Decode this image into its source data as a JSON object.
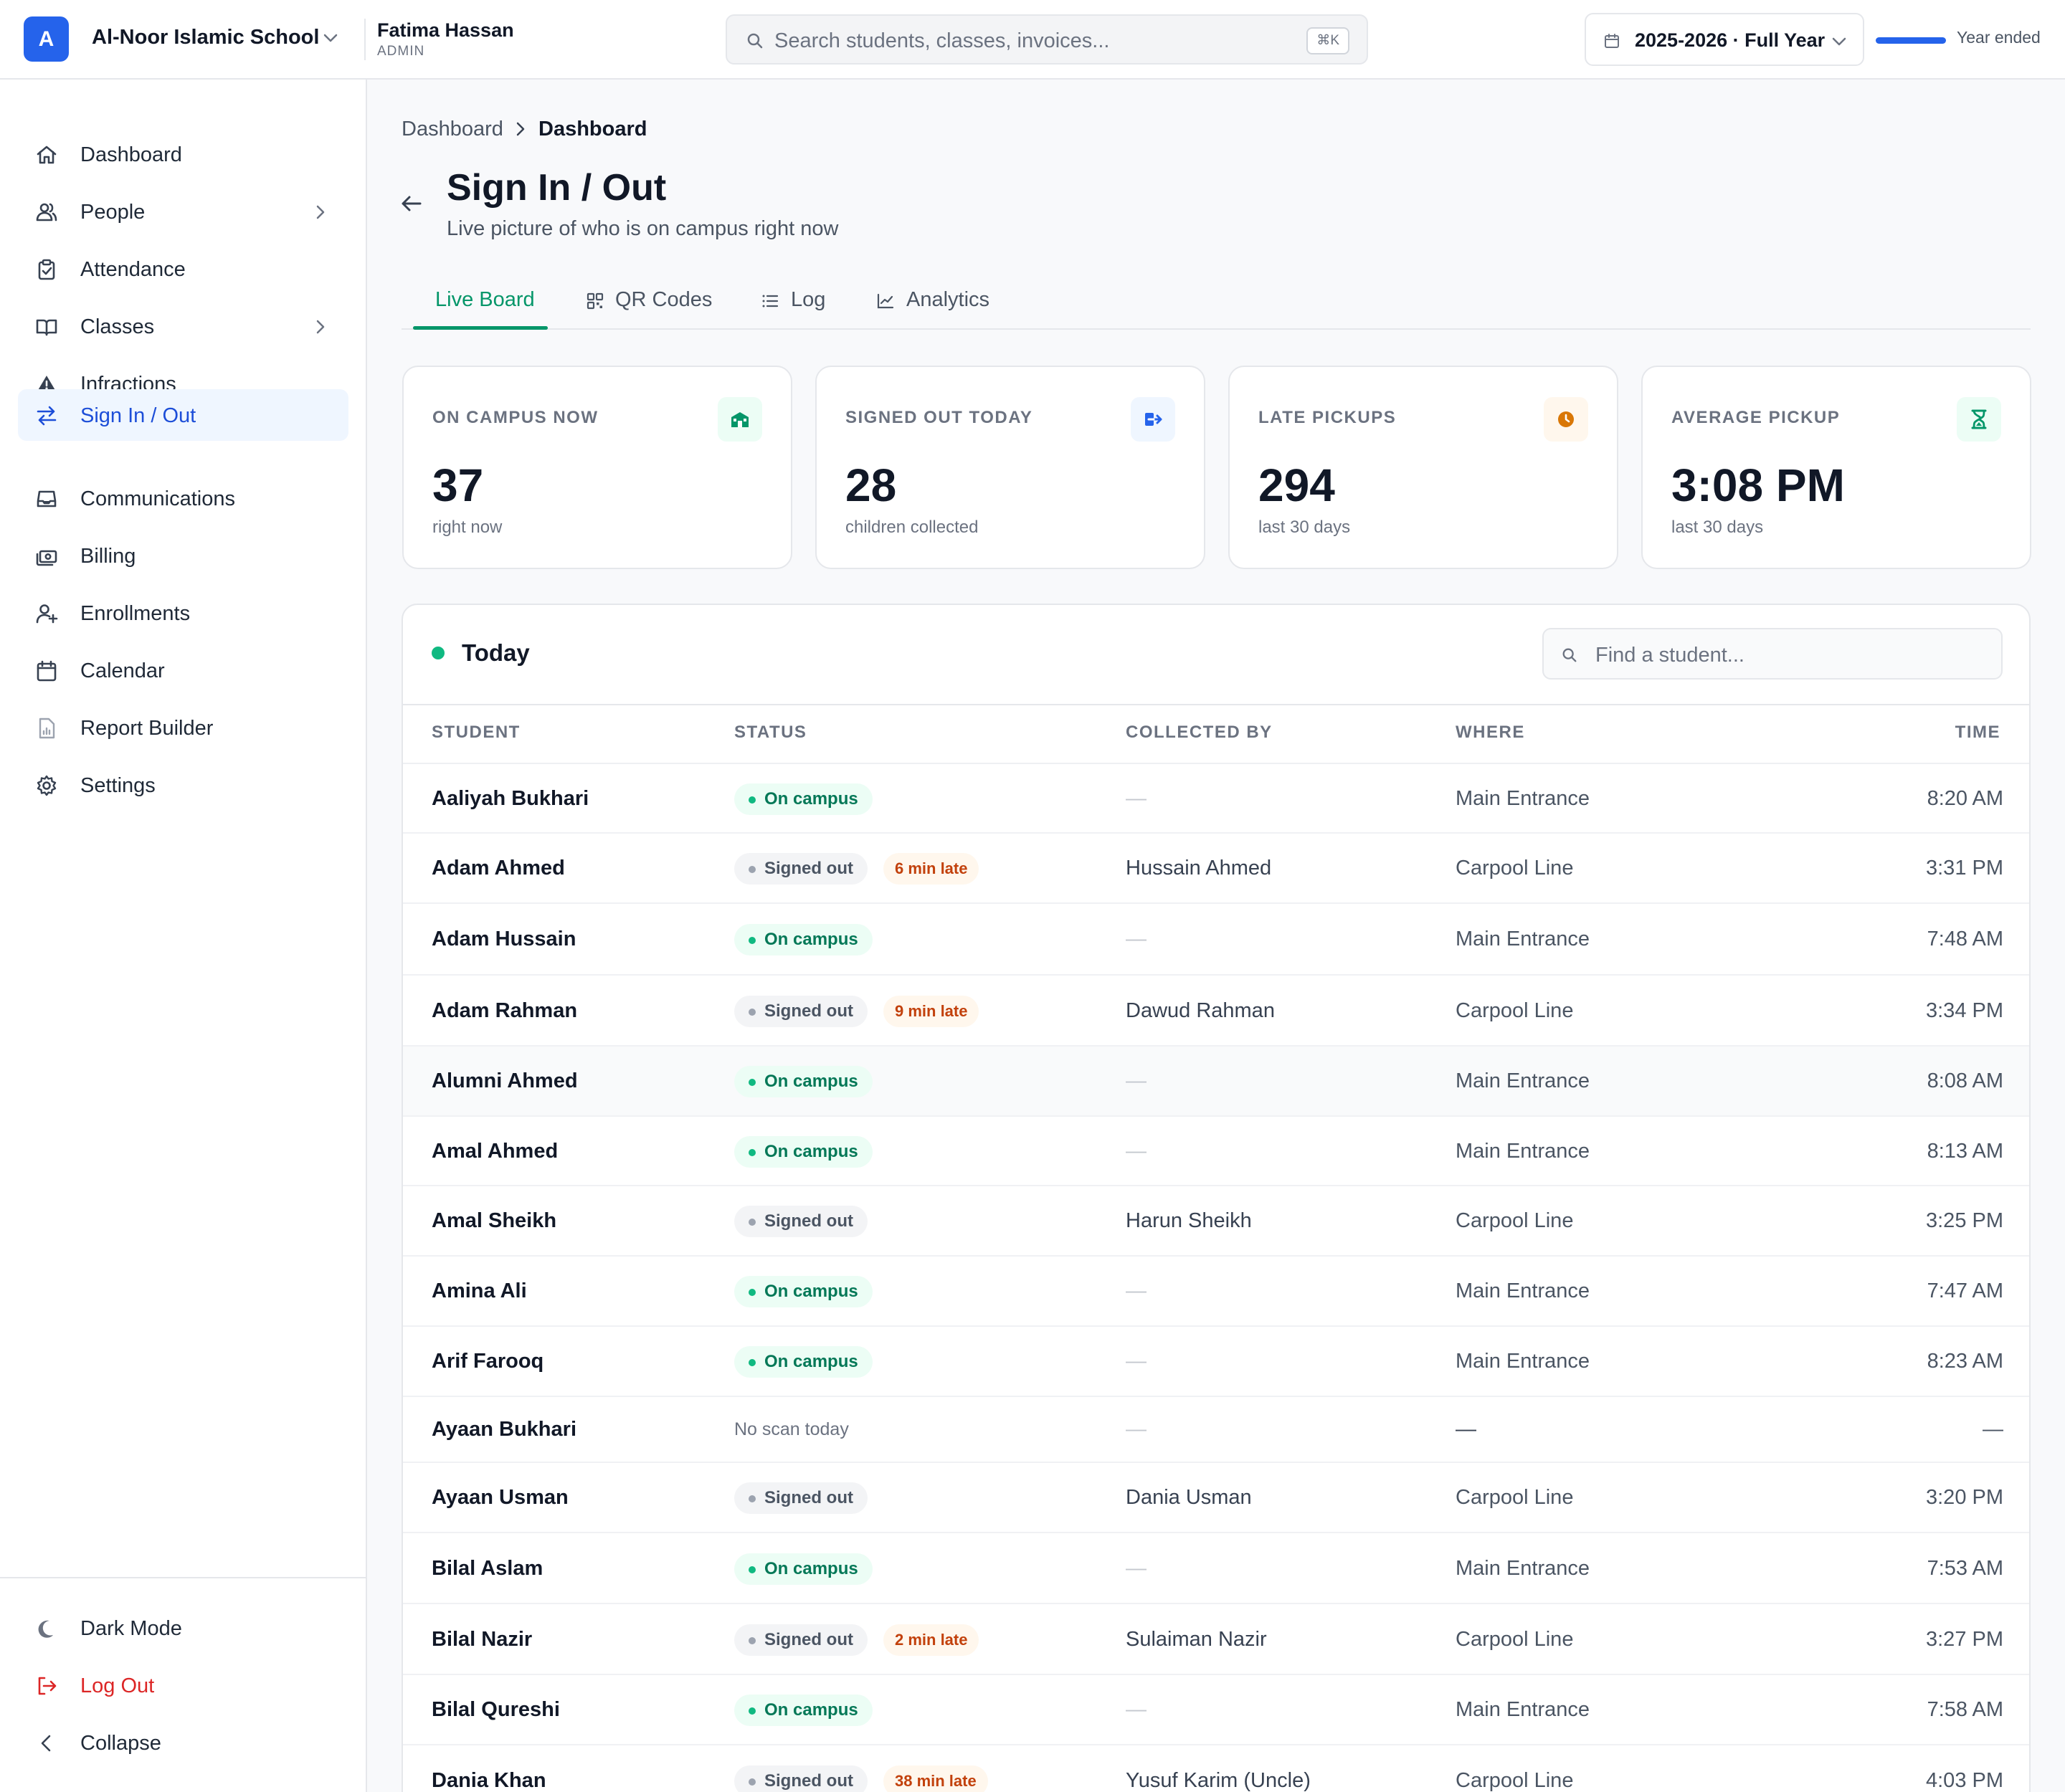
{
  "header": {
    "logo_letter": "A",
    "school": "Al-Noor Islamic School",
    "user_name": "Fatima Hassan",
    "user_role": "ADMIN",
    "search_placeholder": "Search students, classes, invoices...",
    "search_shortcut": "⌘K",
    "year": "2025-2026 · Full Year",
    "year_progress": 1.0,
    "year_status": "Year ended"
  },
  "sidebar": {
    "items": [
      {
        "label": "Dashboard",
        "icon": "home-icon"
      },
      {
        "label": "People",
        "icon": "users-icon",
        "has_children": true
      },
      {
        "label": "Attendance",
        "icon": "clipboard-check-icon"
      },
      {
        "label": "Classes",
        "icon": "book-open-icon",
        "has_children": true
      },
      {
        "label": "Infractions",
        "icon": "warning-icon"
      },
      {
        "label": "Sign In / Out",
        "icon": "arrows-swap-icon",
        "active": true
      },
      {
        "label": "Communications",
        "icon": "inbox-icon"
      },
      {
        "label": "Billing",
        "icon": "banknote-icon"
      },
      {
        "label": "Enrollments",
        "icon": "user-plus-icon"
      },
      {
        "label": "Calendar",
        "icon": "calendar-icon"
      },
      {
        "label": "Report Builder",
        "icon": "report-icon"
      },
      {
        "label": "Settings",
        "icon": "gear-icon"
      }
    ],
    "bottom": {
      "dark_mode": "Dark Mode",
      "log_out": "Log Out",
      "collapse": "Collapse"
    }
  },
  "breadcrumb": {
    "first": "Dashboard",
    "current": "Dashboard"
  },
  "page": {
    "title": "Sign In / Out",
    "subtitle": "Live picture of who is on campus right now"
  },
  "tabs": [
    {
      "label": "Live Board",
      "active": true
    },
    {
      "label": "QR Codes",
      "icon": "qr-icon"
    },
    {
      "label": "Log",
      "icon": "list-icon"
    },
    {
      "label": "Analytics",
      "icon": "chart-icon"
    }
  ],
  "stats": [
    {
      "label": "ON CAMPUS NOW",
      "value": "37",
      "sub": "right now",
      "icon": "school-icon",
      "color": "#059669",
      "bg": "#ecfdf5"
    },
    {
      "label": "SIGNED OUT TODAY",
      "value": "28",
      "sub": "children collected",
      "icon": "sign-out-icon",
      "color": "#2563eb",
      "bg": "#eff6ff"
    },
    {
      "label": "LATE PICKUPS",
      "value": "294",
      "sub": "last 30 days",
      "icon": "clock-icon",
      "color": "#d97706",
      "bg": "#fff7ed"
    },
    {
      "label": "AVERAGE PICKUP",
      "value": "3:08 PM",
      "sub": "last 30 days",
      "icon": "hourglass-icon",
      "color": "#059669",
      "bg": "#ecfdf5"
    }
  ],
  "today": {
    "title": "Today",
    "find_placeholder": "Find a student...",
    "columns": [
      "STUDENT",
      "STATUS",
      "COLLECTED BY",
      "WHERE",
      "TIME"
    ],
    "rows": [
      {
        "name": "Aaliyah Bukhari",
        "status": "On campus",
        "late": "",
        "by": "—",
        "where": "Main Entrance",
        "time": "8:20 AM"
      },
      {
        "name": "Adam Ahmed",
        "status": "Signed out",
        "late": "6 min late",
        "by": "Hussain Ahmed",
        "where": "Carpool Line",
        "time": "3:31 PM"
      },
      {
        "name": "Adam Hussain",
        "status": "On campus",
        "late": "",
        "by": "—",
        "where": "Main Entrance",
        "time": "7:48 AM"
      },
      {
        "name": "Adam Rahman",
        "status": "Signed out",
        "late": "9 min late",
        "by": "Dawud Rahman",
        "where": "Carpool Line",
        "time": "3:34 PM"
      },
      {
        "name": "Alumni Ahmed",
        "status": "On campus",
        "late": "",
        "by": "—",
        "where": "Main Entrance",
        "time": "8:08 AM"
      },
      {
        "name": "Amal Ahmed",
        "status": "On campus",
        "late": "",
        "by": "—",
        "where": "Main Entrance",
        "time": "8:13 AM"
      },
      {
        "name": "Amal Sheikh",
        "status": "Signed out",
        "late": "",
        "by": "Harun Sheikh",
        "where": "Carpool Line",
        "time": "3:25 PM"
      },
      {
        "name": "Amina Ali",
        "status": "On campus",
        "late": "",
        "by": "—",
        "where": "Main Entrance",
        "time": "7:47 AM"
      },
      {
        "name": "Arif Farooq",
        "status": "On campus",
        "late": "",
        "by": "—",
        "where": "Main Entrance",
        "time": "8:23 AM"
      },
      {
        "name": "Ayaan Bukhari",
        "status": "No scan today",
        "late": "",
        "by": "—",
        "where": "—",
        "time": "—"
      },
      {
        "name": "Ayaan Usman",
        "status": "Signed out",
        "late": "",
        "by": "Dania Usman",
        "where": "Carpool Line",
        "time": "3:20 PM"
      },
      {
        "name": "Bilal Aslam",
        "status": "On campus",
        "late": "",
        "by": "—",
        "where": "Main Entrance",
        "time": "7:53 AM"
      },
      {
        "name": "Bilal Nazir",
        "status": "Signed out",
        "late": "2 min late",
        "by": "Sulaiman Nazir",
        "where": "Carpool Line",
        "time": "3:27 PM"
      },
      {
        "name": "Bilal Qureshi",
        "status": "On campus",
        "late": "",
        "by": "—",
        "where": "Main Entrance",
        "time": "7:58 AM"
      },
      {
        "name": "Dania Khan",
        "status": "Signed out",
        "late": "38 min late",
        "by": "Yusuf Karim (Uncle)",
        "where": "Carpool Line",
        "time": "4:03 PM"
      }
    ]
  }
}
